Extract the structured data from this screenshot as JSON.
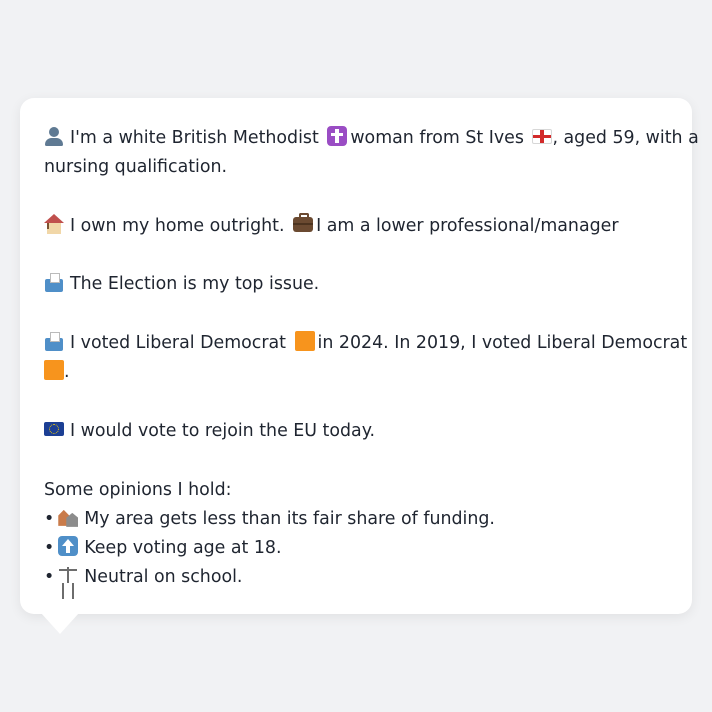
{
  "profile": {
    "intro_1": "I'm a white British Methodist",
    "intro_2": "woman from St Ives",
    "intro_3": ", aged 59, with a",
    "intro_4": "nursing qualification.",
    "home": "I own my home outright.",
    "job": "I am a lower professional/manager",
    "top_issue": "The Election is my top issue.",
    "vote_1": "I voted Liberal Democrat",
    "vote_2": "in 2024. In 2019, I voted Liberal Democrat",
    "vote_3": ".",
    "eu": "I would vote to rejoin the EU today."
  },
  "opinions": {
    "heading": "Some opinions I hold:",
    "bullet": "•",
    "items": [
      {
        "icon": "houses-icon",
        "text": "My area gets less than its fair share of funding."
      },
      {
        "icon": "up-arrow-icon",
        "text": "Keep voting age at 18."
      },
      {
        "icon": "scales-icon",
        "text": "Neutral on school."
      }
    ]
  },
  "icons": {
    "person": "person-icon",
    "religion": "latin-cross-icon",
    "region_flag": "england-flag-icon",
    "home": "house-icon",
    "job": "briefcase-icon",
    "issue": "ballot-box-icon",
    "vote": "ballot-box-icon",
    "party": "orange-square-icon",
    "eu": "eu-flag-icon"
  },
  "colors": {
    "page_background": "#f1f2f4",
    "card_background": "#ffffff",
    "text": "#1f2530",
    "party_orange": "#f7941d"
  }
}
